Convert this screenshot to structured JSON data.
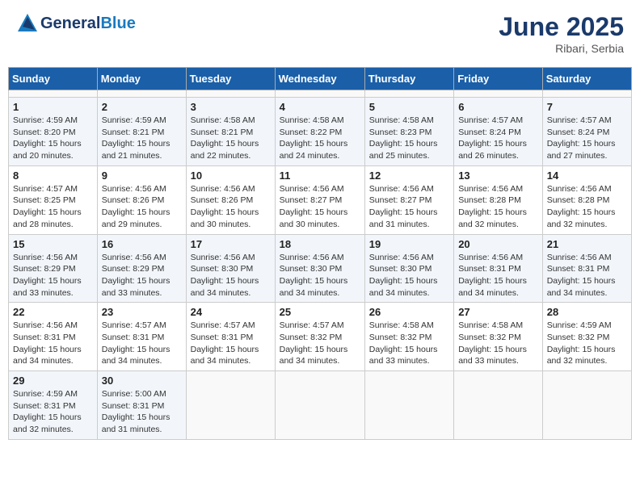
{
  "header": {
    "logo_general": "General",
    "logo_blue": "Blue",
    "title": "June 2025",
    "subtitle": "Ribari, Serbia"
  },
  "calendar": {
    "columns": [
      "Sunday",
      "Monday",
      "Tuesday",
      "Wednesday",
      "Thursday",
      "Friday",
      "Saturday"
    ],
    "weeks": [
      [
        {
          "day": "",
          "sunrise": "",
          "sunset": "",
          "daylight": ""
        },
        {
          "day": "",
          "sunrise": "",
          "sunset": "",
          "daylight": ""
        },
        {
          "day": "",
          "sunrise": "",
          "sunset": "",
          "daylight": ""
        },
        {
          "day": "",
          "sunrise": "",
          "sunset": "",
          "daylight": ""
        },
        {
          "day": "",
          "sunrise": "",
          "sunset": "",
          "daylight": ""
        },
        {
          "day": "",
          "sunrise": "",
          "sunset": "",
          "daylight": ""
        },
        {
          "day": "",
          "sunrise": "",
          "sunset": "",
          "daylight": ""
        }
      ],
      [
        {
          "day": "1",
          "sunrise": "Sunrise: 4:59 AM",
          "sunset": "Sunset: 8:20 PM",
          "daylight": "Daylight: 15 hours and 20 minutes."
        },
        {
          "day": "2",
          "sunrise": "Sunrise: 4:59 AM",
          "sunset": "Sunset: 8:21 PM",
          "daylight": "Daylight: 15 hours and 21 minutes."
        },
        {
          "day": "3",
          "sunrise": "Sunrise: 4:58 AM",
          "sunset": "Sunset: 8:21 PM",
          "daylight": "Daylight: 15 hours and 22 minutes."
        },
        {
          "day": "4",
          "sunrise": "Sunrise: 4:58 AM",
          "sunset": "Sunset: 8:22 PM",
          "daylight": "Daylight: 15 hours and 24 minutes."
        },
        {
          "day": "5",
          "sunrise": "Sunrise: 4:58 AM",
          "sunset": "Sunset: 8:23 PM",
          "daylight": "Daylight: 15 hours and 25 minutes."
        },
        {
          "day": "6",
          "sunrise": "Sunrise: 4:57 AM",
          "sunset": "Sunset: 8:24 PM",
          "daylight": "Daylight: 15 hours and 26 minutes."
        },
        {
          "day": "7",
          "sunrise": "Sunrise: 4:57 AM",
          "sunset": "Sunset: 8:24 PM",
          "daylight": "Daylight: 15 hours and 27 minutes."
        }
      ],
      [
        {
          "day": "8",
          "sunrise": "Sunrise: 4:57 AM",
          "sunset": "Sunset: 8:25 PM",
          "daylight": "Daylight: 15 hours and 28 minutes."
        },
        {
          "day": "9",
          "sunrise": "Sunrise: 4:56 AM",
          "sunset": "Sunset: 8:26 PM",
          "daylight": "Daylight: 15 hours and 29 minutes."
        },
        {
          "day": "10",
          "sunrise": "Sunrise: 4:56 AM",
          "sunset": "Sunset: 8:26 PM",
          "daylight": "Daylight: 15 hours and 30 minutes."
        },
        {
          "day": "11",
          "sunrise": "Sunrise: 4:56 AM",
          "sunset": "Sunset: 8:27 PM",
          "daylight": "Daylight: 15 hours and 30 minutes."
        },
        {
          "day": "12",
          "sunrise": "Sunrise: 4:56 AM",
          "sunset": "Sunset: 8:27 PM",
          "daylight": "Daylight: 15 hours and 31 minutes."
        },
        {
          "day": "13",
          "sunrise": "Sunrise: 4:56 AM",
          "sunset": "Sunset: 8:28 PM",
          "daylight": "Daylight: 15 hours and 32 minutes."
        },
        {
          "day": "14",
          "sunrise": "Sunrise: 4:56 AM",
          "sunset": "Sunset: 8:28 PM",
          "daylight": "Daylight: 15 hours and 32 minutes."
        }
      ],
      [
        {
          "day": "15",
          "sunrise": "Sunrise: 4:56 AM",
          "sunset": "Sunset: 8:29 PM",
          "daylight": "Daylight: 15 hours and 33 minutes."
        },
        {
          "day": "16",
          "sunrise": "Sunrise: 4:56 AM",
          "sunset": "Sunset: 8:29 PM",
          "daylight": "Daylight: 15 hours and 33 minutes."
        },
        {
          "day": "17",
          "sunrise": "Sunrise: 4:56 AM",
          "sunset": "Sunset: 8:30 PM",
          "daylight": "Daylight: 15 hours and 34 minutes."
        },
        {
          "day": "18",
          "sunrise": "Sunrise: 4:56 AM",
          "sunset": "Sunset: 8:30 PM",
          "daylight": "Daylight: 15 hours and 34 minutes."
        },
        {
          "day": "19",
          "sunrise": "Sunrise: 4:56 AM",
          "sunset": "Sunset: 8:30 PM",
          "daylight": "Daylight: 15 hours and 34 minutes."
        },
        {
          "day": "20",
          "sunrise": "Sunrise: 4:56 AM",
          "sunset": "Sunset: 8:31 PM",
          "daylight": "Daylight: 15 hours and 34 minutes."
        },
        {
          "day": "21",
          "sunrise": "Sunrise: 4:56 AM",
          "sunset": "Sunset: 8:31 PM",
          "daylight": "Daylight: 15 hours and 34 minutes."
        }
      ],
      [
        {
          "day": "22",
          "sunrise": "Sunrise: 4:56 AM",
          "sunset": "Sunset: 8:31 PM",
          "daylight": "Daylight: 15 hours and 34 minutes."
        },
        {
          "day": "23",
          "sunrise": "Sunrise: 4:57 AM",
          "sunset": "Sunset: 8:31 PM",
          "daylight": "Daylight: 15 hours and 34 minutes."
        },
        {
          "day": "24",
          "sunrise": "Sunrise: 4:57 AM",
          "sunset": "Sunset: 8:31 PM",
          "daylight": "Daylight: 15 hours and 34 minutes."
        },
        {
          "day": "25",
          "sunrise": "Sunrise: 4:57 AM",
          "sunset": "Sunset: 8:32 PM",
          "daylight": "Daylight: 15 hours and 34 minutes."
        },
        {
          "day": "26",
          "sunrise": "Sunrise: 4:58 AM",
          "sunset": "Sunset: 8:32 PM",
          "daylight": "Daylight: 15 hours and 33 minutes."
        },
        {
          "day": "27",
          "sunrise": "Sunrise: 4:58 AM",
          "sunset": "Sunset: 8:32 PM",
          "daylight": "Daylight: 15 hours and 33 minutes."
        },
        {
          "day": "28",
          "sunrise": "Sunrise: 4:59 AM",
          "sunset": "Sunset: 8:32 PM",
          "daylight": "Daylight: 15 hours and 32 minutes."
        }
      ],
      [
        {
          "day": "29",
          "sunrise": "Sunrise: 4:59 AM",
          "sunset": "Sunset: 8:31 PM",
          "daylight": "Daylight: 15 hours and 32 minutes."
        },
        {
          "day": "30",
          "sunrise": "Sunrise: 5:00 AM",
          "sunset": "Sunset: 8:31 PM",
          "daylight": "Daylight: 15 hours and 31 minutes."
        },
        {
          "day": "",
          "sunrise": "",
          "sunset": "",
          "daylight": ""
        },
        {
          "day": "",
          "sunrise": "",
          "sunset": "",
          "daylight": ""
        },
        {
          "day": "",
          "sunrise": "",
          "sunset": "",
          "daylight": ""
        },
        {
          "day": "",
          "sunrise": "",
          "sunset": "",
          "daylight": ""
        },
        {
          "day": "",
          "sunrise": "",
          "sunset": "",
          "daylight": ""
        }
      ]
    ]
  }
}
